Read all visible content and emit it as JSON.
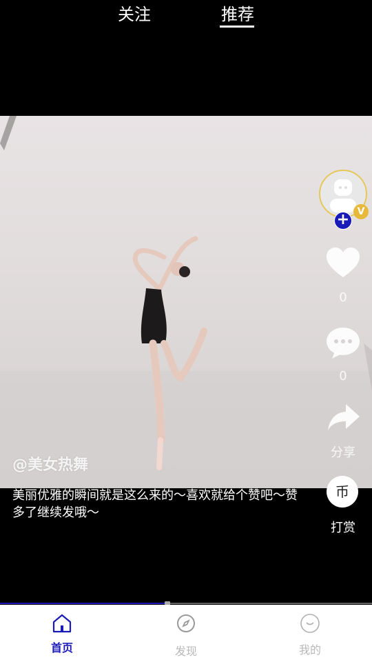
{
  "top_tabs": {
    "follow": "关注",
    "recommend": "推荐",
    "active": "recommend"
  },
  "video": {
    "watermark": "@美女热舞",
    "caption": "美丽优雅的瞬间就是这么来的～喜欢就给个赞吧～赞多了继续发哦～"
  },
  "actions": {
    "avatar_badge": "V",
    "follow_icon": "plus-icon",
    "like_count": "0",
    "comment_count": "0",
    "share_label": "分享",
    "reward_label": "打赏",
    "reward_glyph": "币"
  },
  "progress": {
    "fraction": 0.45
  },
  "bottom_nav": {
    "home": "首页",
    "discover": "发现",
    "me": "我的"
  },
  "colors": {
    "accent": "#1a1ab8",
    "avatar_ring": "#e6c85a",
    "inactive_nav": "#b8b8b8"
  }
}
